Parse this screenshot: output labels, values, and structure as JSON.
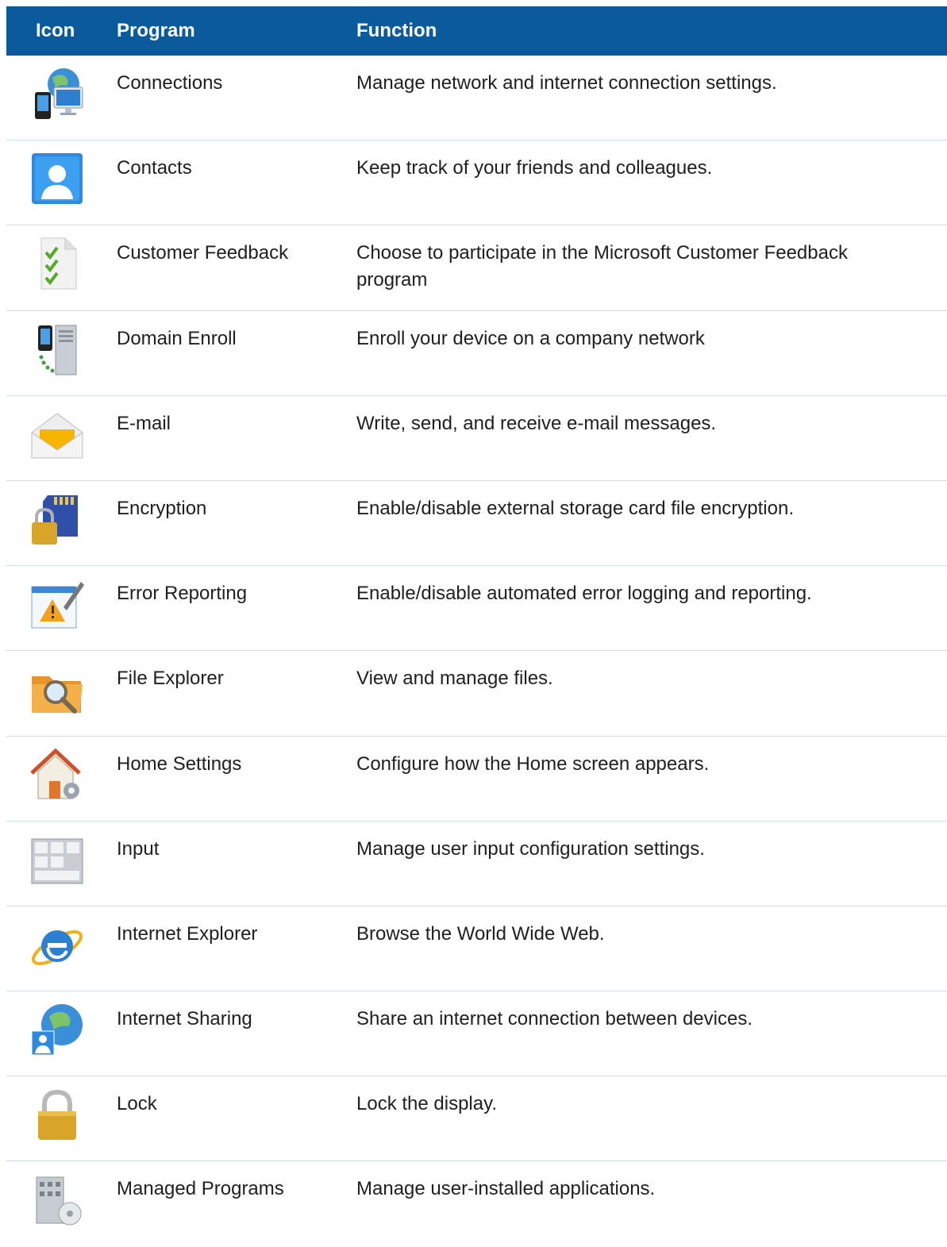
{
  "headers": {
    "icon": "Icon",
    "program": "Program",
    "function": "Function"
  },
  "rows": [
    {
      "icon": "connections-icon",
      "program": "Connections",
      "function": "Manage network and internet connection settings."
    },
    {
      "icon": "contacts-icon",
      "program": "Contacts",
      "function": "Keep track of your friends and colleagues."
    },
    {
      "icon": "customer-feedback-icon",
      "program": "Customer Feedback",
      "function": "Choose to participate in the Microsoft Customer Feedback program"
    },
    {
      "icon": "domain-enroll-icon",
      "program": "Domain Enroll",
      "function": "Enroll your device on a company network"
    },
    {
      "icon": "email-icon",
      "program": "E-mail",
      "function": "Write, send, and receive e-mail messages."
    },
    {
      "icon": "encryption-icon",
      "program": "Encryption",
      "function": "Enable/disable external storage card file encryption."
    },
    {
      "icon": "error-reporting-icon",
      "program": "Error Reporting",
      "function": "Enable/disable automated error logging and reporting."
    },
    {
      "icon": "file-explorer-icon",
      "program": "File Explorer",
      "function": "View and manage files."
    },
    {
      "icon": "home-settings-icon",
      "program": "Home Settings",
      "function": "Configure how the Home screen appears."
    },
    {
      "icon": "input-icon",
      "program": "Input",
      "function": "Manage user input configuration settings."
    },
    {
      "icon": "internet-explorer-icon",
      "program": "Internet Explorer",
      "function": "Browse the World Wide Web."
    },
    {
      "icon": "internet-sharing-icon",
      "program": "Internet Sharing",
      "function": "Share an internet connection between devices."
    },
    {
      "icon": "lock-icon",
      "program": "Lock",
      "function": "Lock the display."
    },
    {
      "icon": "managed-programs-icon",
      "program": "Managed Programs",
      "function": "Manage user-installed applications."
    }
  ],
  "colors": {
    "header_bg": "#0a5a9c",
    "header_text": "#ffffff",
    "row_divider": "#cfdde9"
  }
}
